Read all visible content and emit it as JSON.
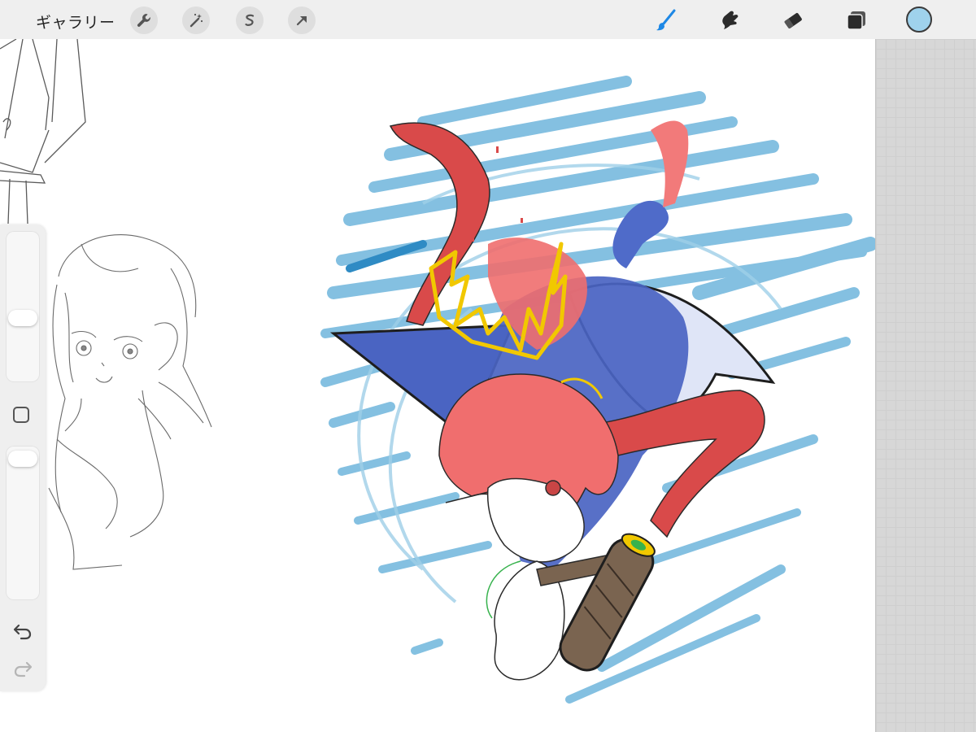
{
  "topbar": {
    "gallery_label": "ギャラリー",
    "actions": [
      {
        "name": "wrench-icon"
      },
      {
        "name": "magic-wand-icon"
      },
      {
        "name": "selection-icon"
      },
      {
        "name": "transform-arrow-icon"
      }
    ],
    "tools": [
      {
        "name": "brush-icon",
        "active": true
      },
      {
        "name": "smudge-icon",
        "active": false
      },
      {
        "name": "eraser-icon",
        "active": false
      },
      {
        "name": "layers-icon",
        "active": false
      }
    ],
    "current_color": "#9fd2ec",
    "active_tool_color": "#1e88e5"
  },
  "sidebar": {
    "brush_size_level": 0.3,
    "opacity_level": 0.05,
    "modify_icon": "square-icon",
    "undo_icon": "undo-icon",
    "redo_icon": "redo-icon"
  },
  "canvas": {
    "background": "#ffffff",
    "palette": {
      "scribble_blue": "#6fb6dc",
      "deep_blue": "#4a64c2",
      "red": "#d94a4a",
      "pink_hair": "#f06e6e",
      "yellow": "#f1c800",
      "brown": "#7a6450",
      "pencil": "#555555"
    }
  }
}
